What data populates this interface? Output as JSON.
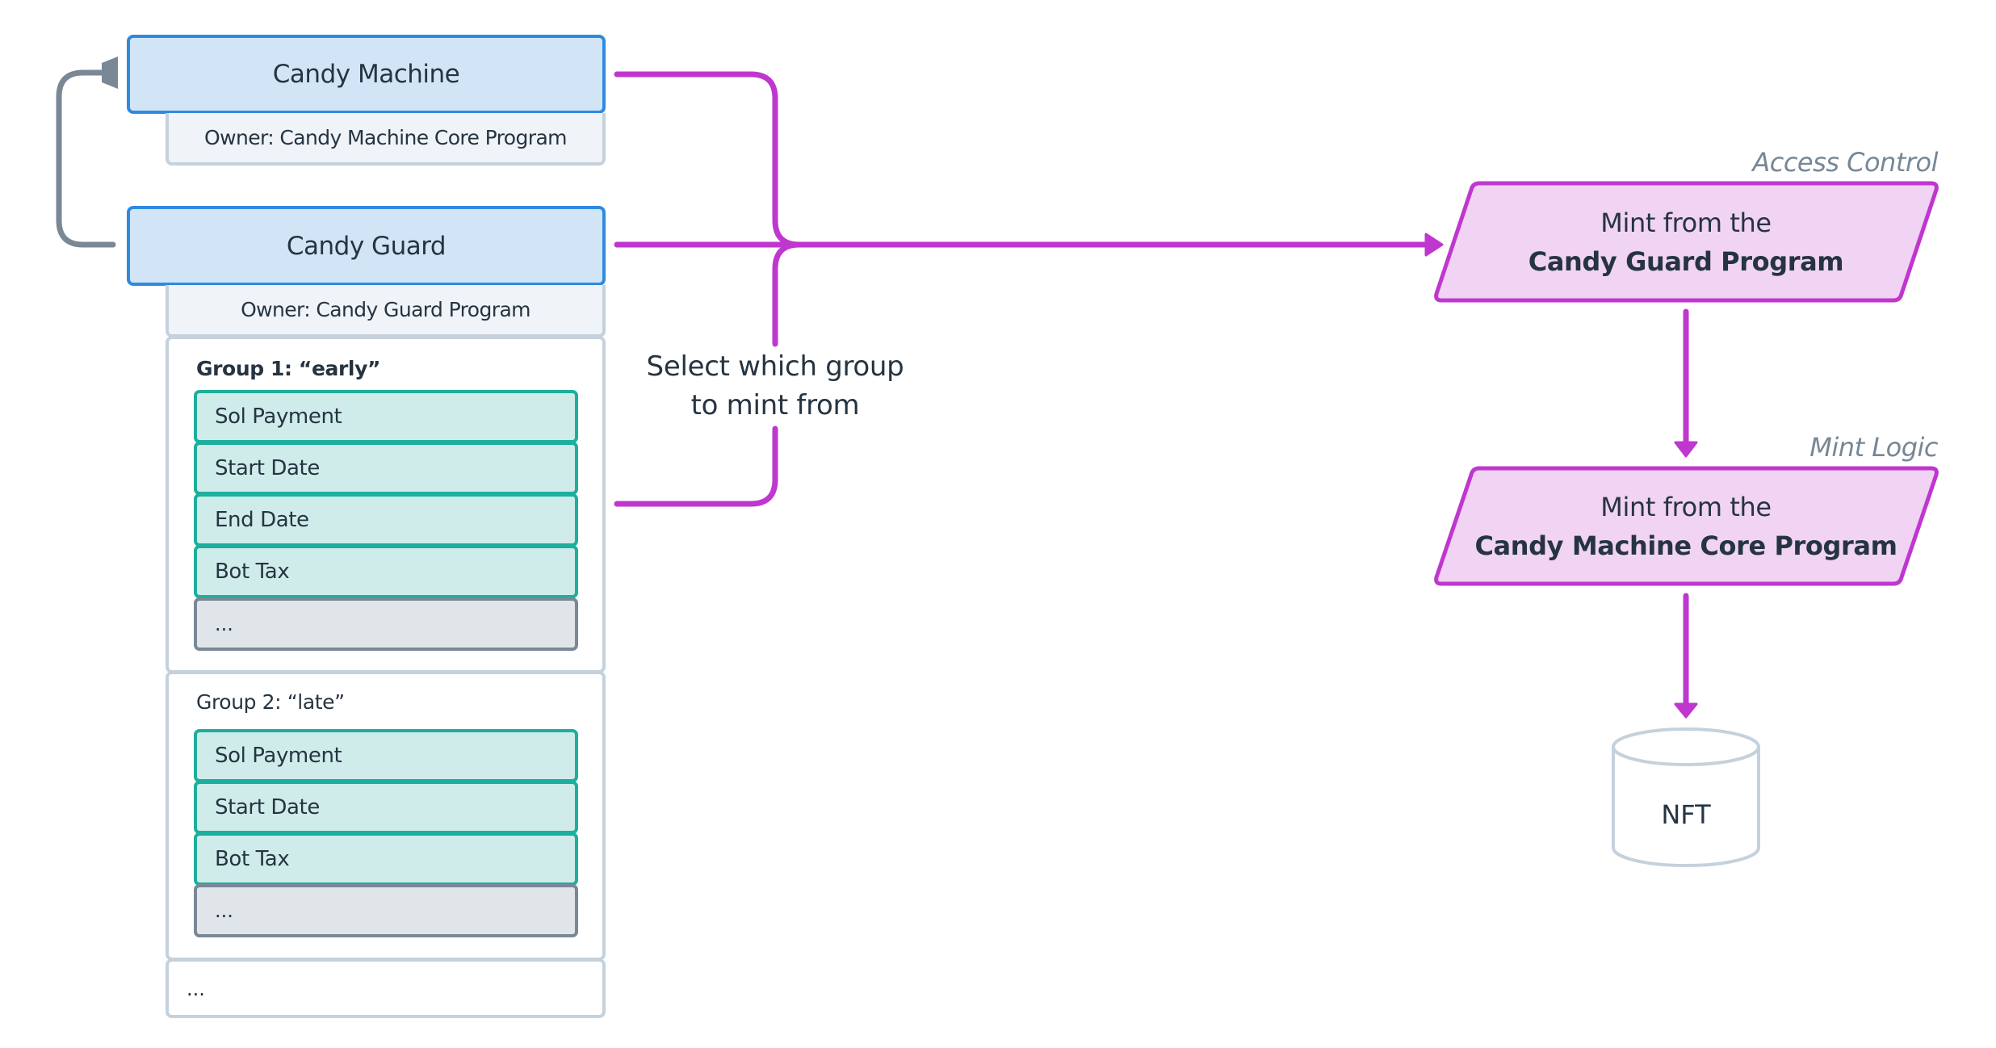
{
  "colors": {
    "account_fill": "#d2e5f6",
    "account_border": "#2e8ade",
    "owner_fill": "#f0f4f8",
    "neutral_border": "#c5d1dc",
    "guard_fill": "#cfecea",
    "guard_border": "#1daf9d",
    "more_fill": "#e0e5e9",
    "more_border": "#7a8896",
    "flow_line": "#bf37cf",
    "flow_fill": "#f1d3f3",
    "link_gray": "#7a8896",
    "text": "#263442",
    "label_gray": "#778796"
  },
  "accounts": {
    "candy_machine": {
      "title": "Candy Machine",
      "owner": "Owner: Candy Machine Core Program"
    },
    "candy_guard": {
      "title": "Candy Guard",
      "owner": "Owner: Candy Guard Program"
    }
  },
  "groups": [
    {
      "title": "Group 1: “early”",
      "highlighted": true,
      "guards": [
        "Sol Payment",
        "Start Date",
        "End Date",
        "Bot Tax"
      ],
      "more": "..."
    },
    {
      "title": "Group 2: “late”",
      "highlighted": false,
      "guards": [
        "Sol Payment",
        "Start Date",
        "Bot Tax"
      ],
      "more": "..."
    }
  ],
  "more_groups": "...",
  "select_label": {
    "line1": "Select which group",
    "line2": "to mint from"
  },
  "flow": {
    "steps": [
      {
        "label": "Access Control",
        "line1": "Mint from the",
        "line2": "Candy Guard Program"
      },
      {
        "label": "Mint Logic",
        "line1": "Mint from the",
        "line2": "Candy Machine Core Program"
      }
    ],
    "output": "NFT"
  }
}
